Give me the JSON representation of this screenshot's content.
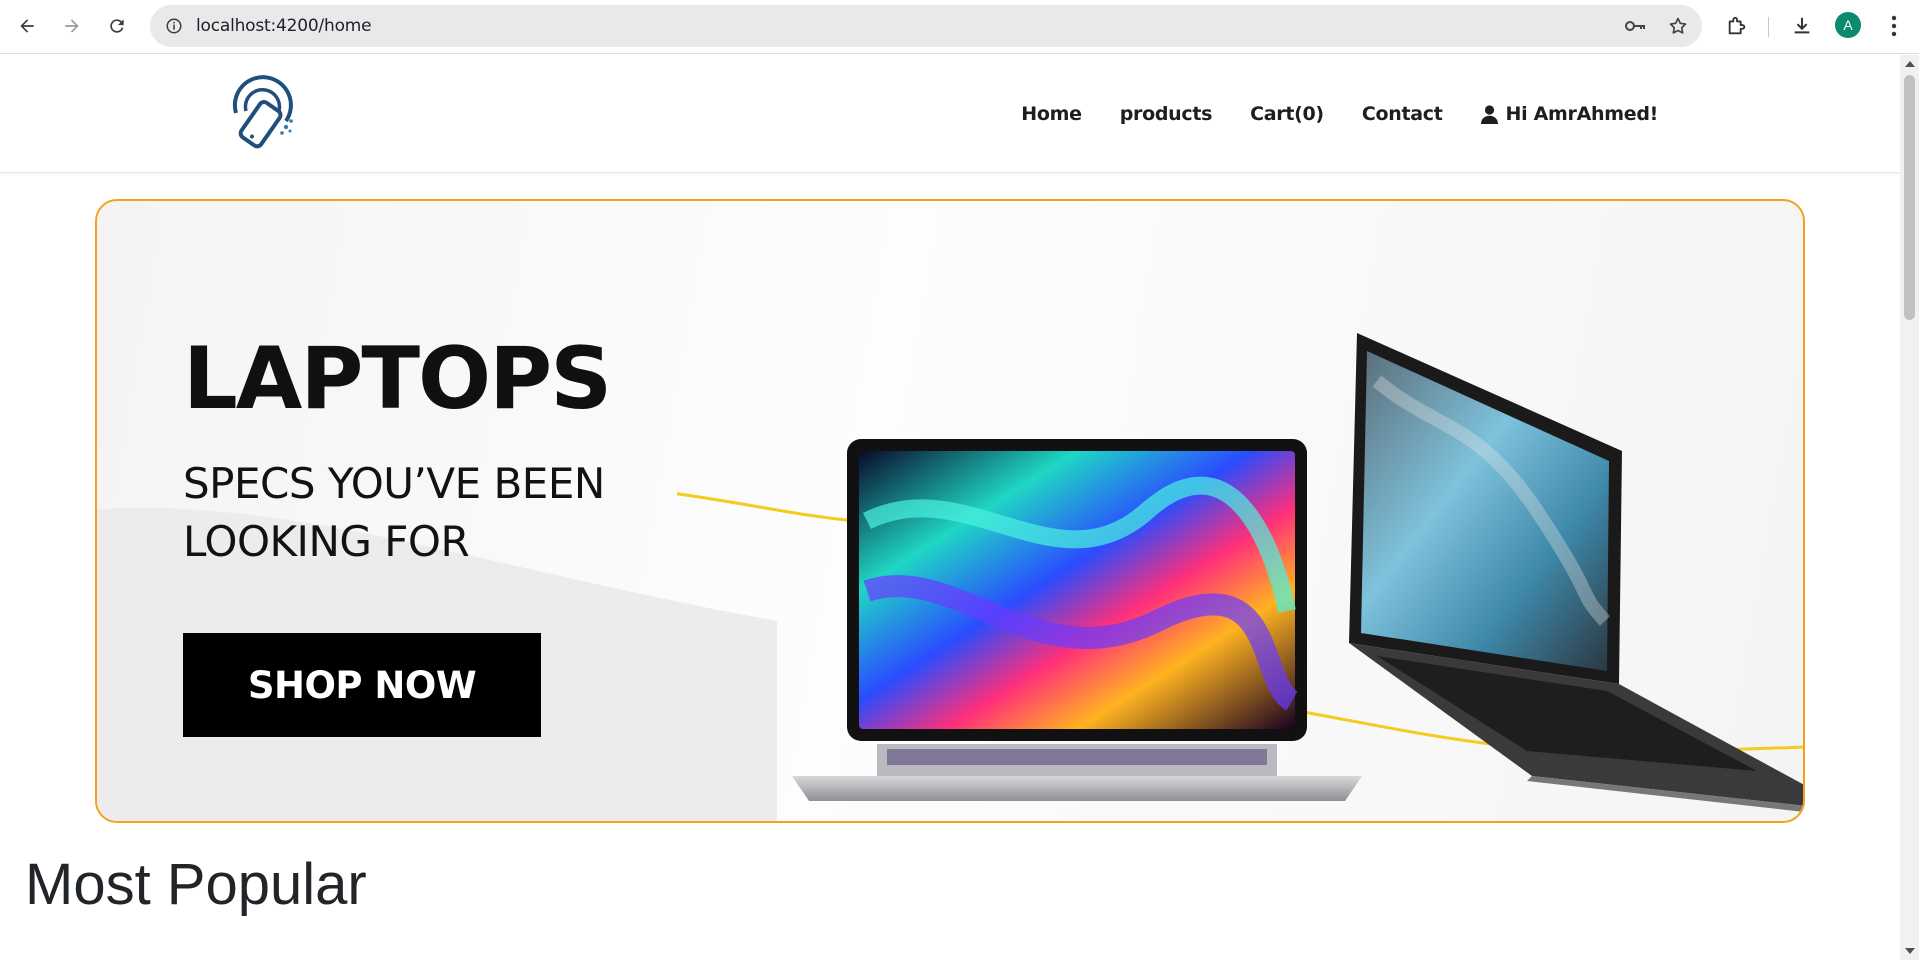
{
  "browser": {
    "url": "localhost:4200/home",
    "avatar_letter": "A"
  },
  "site": {
    "nav": [
      {
        "label": "Home"
      },
      {
        "label": "products"
      },
      {
        "label": "Cart(0)"
      },
      {
        "label": "Contact"
      },
      {
        "label": "Hi AmrAhmed!",
        "icon": "user-icon"
      }
    ]
  },
  "banner": {
    "title": "LAPTOPS",
    "subtitle_line1": "SPECS YOU’VE BEEN",
    "subtitle_line2": "LOOKING FOR",
    "cta": "SHOP NOW",
    "border_color": "#f5a21b"
  },
  "sections": {
    "most_popular": "Most Popular"
  }
}
